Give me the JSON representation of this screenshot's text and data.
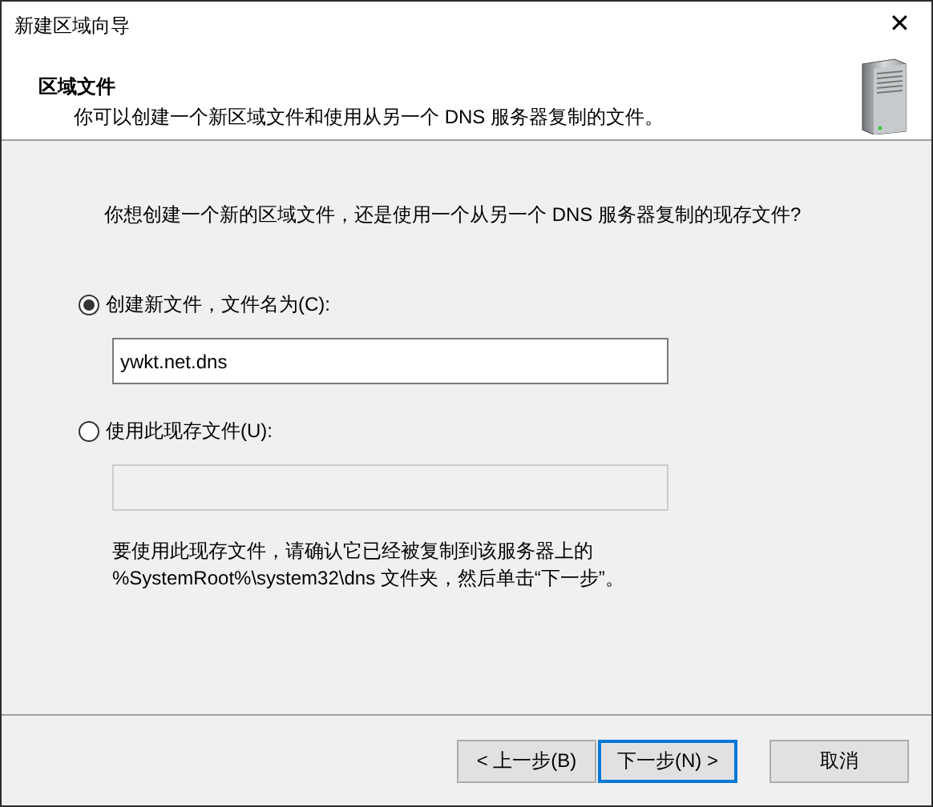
{
  "window": {
    "title": "新建区域向导",
    "close": "✕"
  },
  "header": {
    "title": "区域文件",
    "subtitle": "你可以创建一个新区域文件和使用从另一个 DNS 服务器复制的文件。"
  },
  "question": "你想创建一个新的区域文件，还是使用一个从另一个 DNS 服务器复制的现存文件?",
  "options": [
    {
      "label": "创建新文件，文件名为(C):",
      "selected": true,
      "value": "ywkt.net.dns"
    },
    {
      "label": "使用此现存文件(U):",
      "selected": false
    }
  ],
  "note_lines": [
    "要使用此现存文件，请确认它已经被复制到该服务器上的",
    "%SystemRoot%\\system32\\dns 文件夹，然后单击“下一步”。"
  ],
  "buttons": [
    {
      "label": "< 上一步(B)",
      "default": false
    },
    {
      "label": "下一步(N) >",
      "default": true
    },
    {
      "label": "取消",
      "default": false
    }
  ]
}
